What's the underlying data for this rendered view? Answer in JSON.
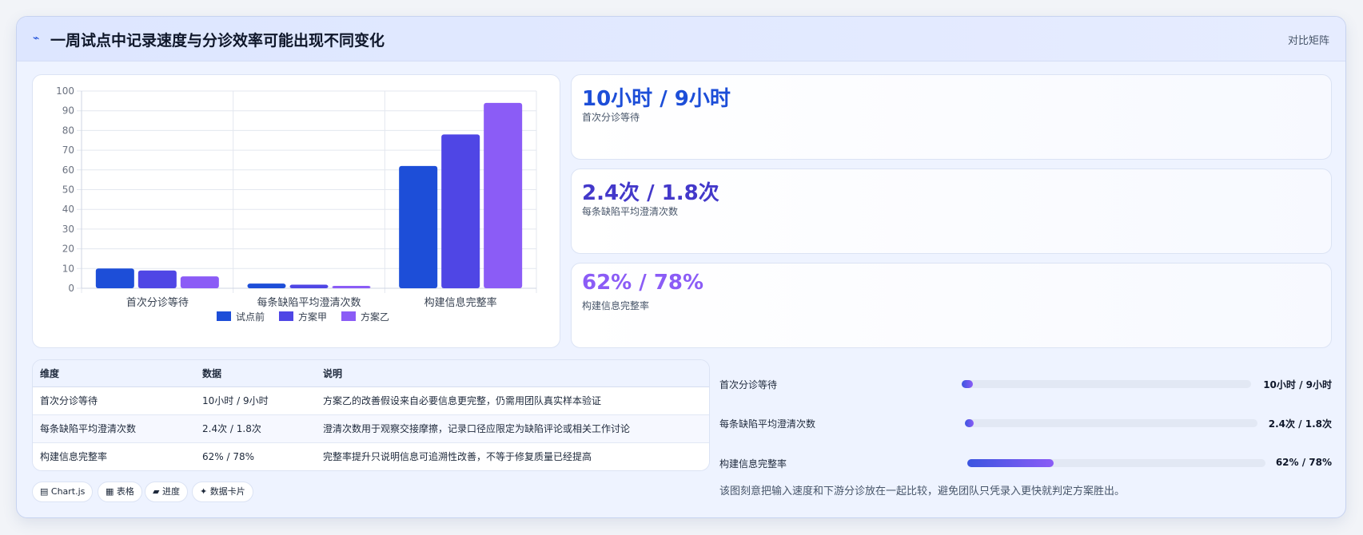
{
  "header": {
    "icon": "pulse-icon",
    "title": "一周试点中记录速度与分诊效率可能出现不同变化",
    "tag": "对比矩阵"
  },
  "chart_data": {
    "type": "bar",
    "categories": [
      "首次分诊等待",
      "每条缺陷平均澄清次数",
      "构建信息完整率"
    ],
    "series": [
      {
        "name": "试点前",
        "values": [
          10,
          2.4,
          62
        ],
        "color": "#1d4ed8"
      },
      {
        "name": "方案甲",
        "values": [
          9,
          1.8,
          78
        ],
        "color": "#4f46e5"
      },
      {
        "name": "方案乙",
        "values": [
          6,
          1.2,
          94
        ],
        "color": "#8b5cf6"
      }
    ],
    "ylim": [
      0,
      100
    ],
    "yticks": [
      0,
      10,
      20,
      30,
      40,
      50,
      60,
      70,
      80,
      90,
      100
    ],
    "grid": true,
    "legend": "bottom"
  },
  "kpis": [
    {
      "value": "10小时 / 9小时",
      "label": "首次分诊等待",
      "color": "#1d4ed8"
    },
    {
      "value": "2.4次 / 1.8次",
      "label": "每条缺陷平均澄清次数",
      "color": "#4338ca"
    },
    {
      "value": "62% / 78%",
      "label": "构建信息完整率",
      "color": "#8b5cf6"
    }
  ],
  "table": {
    "headers": [
      "维度",
      "数据",
      "说明"
    ],
    "rows": [
      [
        "首次分诊等待",
        "10小时 / 9小时",
        "方案乙的改善假设来自必要信息更完整，仍需用团队真实样本验证"
      ],
      [
        "每条缺陷平均澄清次数",
        "2.4次 / 1.8次",
        "澄清次数用于观察交接摩擦，记录口径应限定为缺陷评论或相关工作讨论"
      ],
      [
        "构建信息完整率",
        "62% / 78%",
        "完整率提升只说明信息可追溯性改善，不等于修复质量已经提高"
      ]
    ]
  },
  "chips": [
    {
      "icon": "chart-icon",
      "label": "▤ Chart.js"
    },
    {
      "icon": "table-icon",
      "label": "▦ 表格"
    },
    {
      "icon": "progress-icon",
      "label": "▰ 进度"
    },
    {
      "icon": "sparkle-icon",
      "label": "✦ 数据卡片"
    }
  ],
  "progress": [
    {
      "label": "首次分诊等待",
      "value": "10小时 / 9小时",
      "fraction": 0.04
    },
    {
      "label": "每条缺陷平均澄清次数",
      "value": "2.4次 / 1.8次",
      "fraction": 0.03
    },
    {
      "label": "构建信息完整率",
      "value": "62% / 78%",
      "fraction": 0.29
    }
  ],
  "note": "该图刻意把输入速度和下游分诊放在一起比较，避免团队只凭录入更快就判定方案胜出。"
}
